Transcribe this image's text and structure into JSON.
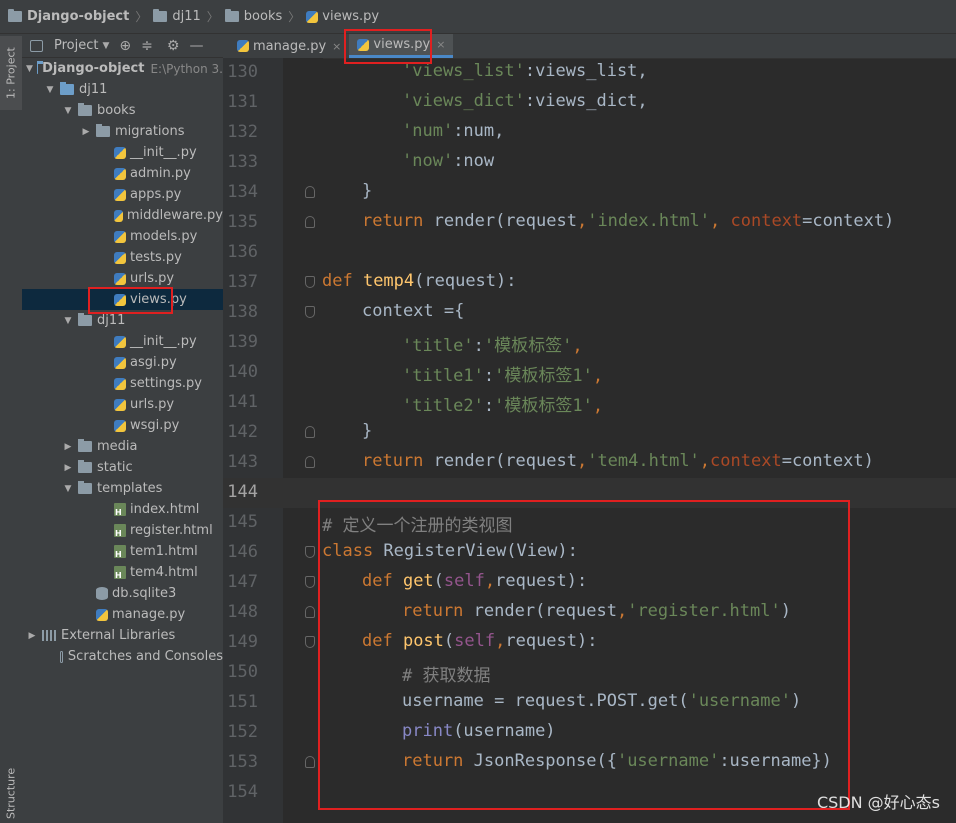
{
  "breadcrumb": [
    "Django-object",
    "dj11",
    "books",
    "views.py"
  ],
  "sidebar": {
    "project_tab": "1: Project",
    "structure_tab": "Structure"
  },
  "project_panel": {
    "header": "Project",
    "tree": [
      {
        "label": "Django-object",
        "sub": "E:\\Python 3.",
        "level": 0,
        "type": "folder-blue",
        "arrow": "open"
      },
      {
        "label": "dj11",
        "level": 1,
        "type": "folder-blue",
        "arrow": "open"
      },
      {
        "label": "books",
        "level": 2,
        "type": "folder",
        "arrow": "open"
      },
      {
        "label": "migrations",
        "level": 3,
        "type": "folder",
        "arrow": "closed"
      },
      {
        "label": "__init__.py",
        "level": 4,
        "type": "py"
      },
      {
        "label": "admin.py",
        "level": 4,
        "type": "py"
      },
      {
        "label": "apps.py",
        "level": 4,
        "type": "py"
      },
      {
        "label": "middleware.py",
        "level": 4,
        "type": "py"
      },
      {
        "label": "models.py",
        "level": 4,
        "type": "py"
      },
      {
        "label": "tests.py",
        "level": 4,
        "type": "py"
      },
      {
        "label": "urls.py",
        "level": 4,
        "type": "py"
      },
      {
        "label": "views.py",
        "level": 4,
        "type": "py",
        "selected": true
      },
      {
        "label": "dj11",
        "level": 2,
        "type": "folder",
        "arrow": "open"
      },
      {
        "label": "__init__.py",
        "level": 4,
        "type": "py"
      },
      {
        "label": "asgi.py",
        "level": 4,
        "type": "py"
      },
      {
        "label": "settings.py",
        "level": 4,
        "type": "py"
      },
      {
        "label": "urls.py",
        "level": 4,
        "type": "py"
      },
      {
        "label": "wsgi.py",
        "level": 4,
        "type": "py"
      },
      {
        "label": "media",
        "level": 2,
        "type": "folder",
        "arrow": "closed"
      },
      {
        "label": "static",
        "level": 2,
        "type": "folder",
        "arrow": "closed"
      },
      {
        "label": "templates",
        "level": 2,
        "type": "folder",
        "arrow": "open"
      },
      {
        "label": "index.html",
        "level": 4,
        "type": "html"
      },
      {
        "label": "register.html",
        "level": 4,
        "type": "html"
      },
      {
        "label": "tem1.html",
        "level": 4,
        "type": "html"
      },
      {
        "label": "tem4.html",
        "level": 4,
        "type": "html"
      },
      {
        "label": "db.sqlite3",
        "level": 3,
        "type": "db"
      },
      {
        "label": "manage.py",
        "level": 3,
        "type": "py"
      },
      {
        "label": "External Libraries",
        "level": 0,
        "type": "lib",
        "arrow": "closed"
      },
      {
        "label": "Scratches and Consoles",
        "level": 1,
        "type": "scratch"
      }
    ]
  },
  "tabs": [
    {
      "label": "manage.py",
      "active": false
    },
    {
      "label": "views.py",
      "active": true
    }
  ],
  "code": {
    "current_line": 144,
    "lines": [
      {
        "n": 130,
        "indent": 2,
        "tokens": [
          [
            "str",
            "'views_list'"
          ],
          [
            "p",
            ":views_list,"
          ]
        ]
      },
      {
        "n": 131,
        "indent": 2,
        "tokens": [
          [
            "str",
            "'views_dict'"
          ],
          [
            "p",
            ":views_dict,"
          ]
        ]
      },
      {
        "n": 132,
        "indent": 2,
        "tokens": [
          [
            "str",
            "'num'"
          ],
          [
            "p",
            ":num,"
          ]
        ]
      },
      {
        "n": 133,
        "indent": 2,
        "tokens": [
          [
            "str",
            "'now'"
          ],
          [
            "p",
            ":now"
          ]
        ]
      },
      {
        "n": 134,
        "indent": 1,
        "tokens": [
          [
            "p",
            "}"
          ]
        ],
        "fold": "end"
      },
      {
        "n": 135,
        "indent": 1,
        "tokens": [
          [
            "kw",
            "return "
          ],
          [
            "p",
            "render(request"
          ],
          [
            "kw",
            ","
          ],
          [
            "str",
            "'index.html'"
          ],
          [
            "kw",
            ", "
          ],
          [
            "kwarg",
            "context"
          ],
          [
            "p",
            "=context)"
          ]
        ],
        "fold": "end"
      },
      {
        "n": 136,
        "indent": 0,
        "tokens": []
      },
      {
        "n": 137,
        "indent": 0,
        "tokens": [
          [
            "kw",
            "def "
          ],
          [
            "fn",
            "temp4"
          ],
          [
            "p",
            "(request):"
          ]
        ],
        "fold": "start"
      },
      {
        "n": 138,
        "indent": 1,
        "tokens": [
          [
            "p",
            "context ={"
          ]
        ],
        "fold": "start"
      },
      {
        "n": 139,
        "indent": 2,
        "tokens": [
          [
            "str",
            "'title'"
          ],
          [
            "p",
            ":"
          ],
          [
            "str",
            "'模板标签'"
          ],
          [
            "kw",
            ","
          ]
        ]
      },
      {
        "n": 140,
        "indent": 2,
        "tokens": [
          [
            "str",
            "'title1'"
          ],
          [
            "p",
            ":"
          ],
          [
            "str",
            "'模板标签1'"
          ],
          [
            "kw",
            ","
          ]
        ]
      },
      {
        "n": 141,
        "indent": 2,
        "tokens": [
          [
            "str",
            "'title2'"
          ],
          [
            "p",
            ":"
          ],
          [
            "str",
            "'模板标签1'"
          ],
          [
            "kw",
            ","
          ]
        ]
      },
      {
        "n": 142,
        "indent": 1,
        "tokens": [
          [
            "p",
            "}"
          ]
        ],
        "fold": "end"
      },
      {
        "n": 143,
        "indent": 1,
        "tokens": [
          [
            "kw",
            "return "
          ],
          [
            "p",
            "render(request"
          ],
          [
            "kw",
            ","
          ],
          [
            "str",
            "'tem4.html'"
          ],
          [
            "kw",
            ","
          ],
          [
            "kwarg",
            "context"
          ],
          [
            "p",
            "=context)"
          ]
        ],
        "fold": "end"
      },
      {
        "n": 144,
        "indent": 0,
        "tokens": []
      },
      {
        "n": 145,
        "indent": 0,
        "tokens": [
          [
            "cmt",
            "# 定义一个注册的类视图"
          ]
        ]
      },
      {
        "n": 146,
        "indent": 0,
        "tokens": [
          [
            "kw",
            "class "
          ],
          [
            "p",
            "RegisterView(View):"
          ]
        ],
        "fold": "start"
      },
      {
        "n": 147,
        "indent": 1,
        "tokens": [
          [
            "kw",
            "def "
          ],
          [
            "fn",
            "get"
          ],
          [
            "p",
            "("
          ],
          [
            "slf",
            "self"
          ],
          [
            "kw",
            ","
          ],
          [
            "p",
            "request):"
          ]
        ],
        "fold": "start"
      },
      {
        "n": 148,
        "indent": 2,
        "tokens": [
          [
            "kw",
            "return "
          ],
          [
            "p",
            "render(request"
          ],
          [
            "kw",
            ","
          ],
          [
            "str",
            "'register.html'"
          ],
          [
            "p",
            ")"
          ]
        ],
        "fold": "end"
      },
      {
        "n": 149,
        "indent": 1,
        "tokens": [
          [
            "kw",
            "def "
          ],
          [
            "fn",
            "post"
          ],
          [
            "p",
            "("
          ],
          [
            "slf",
            "self"
          ],
          [
            "kw",
            ","
          ],
          [
            "p",
            "request):"
          ]
        ],
        "fold": "start"
      },
      {
        "n": 150,
        "indent": 2,
        "tokens": [
          [
            "cmt",
            "# 获取数据"
          ]
        ]
      },
      {
        "n": 151,
        "indent": 2,
        "tokens": [
          [
            "p",
            "username = request.POST.get("
          ],
          [
            "str",
            "'username'"
          ],
          [
            "p",
            ")"
          ]
        ]
      },
      {
        "n": 152,
        "indent": 2,
        "tokens": [
          [
            "bi",
            "print"
          ],
          [
            "p",
            "(username)"
          ]
        ]
      },
      {
        "n": 153,
        "indent": 2,
        "tokens": [
          [
            "kw",
            "return "
          ],
          [
            "p",
            "JsonResponse({"
          ],
          [
            "str",
            "'username'"
          ],
          [
            "p",
            ":username})"
          ]
        ],
        "fold": "end"
      },
      {
        "n": 154,
        "indent": 0,
        "tokens": []
      }
    ]
  },
  "watermark": "CSDN @好心态s",
  "colors": {
    "highlight_box": "#e02020",
    "selection": "#0d293e",
    "tab_underline": "#4a88c7"
  }
}
